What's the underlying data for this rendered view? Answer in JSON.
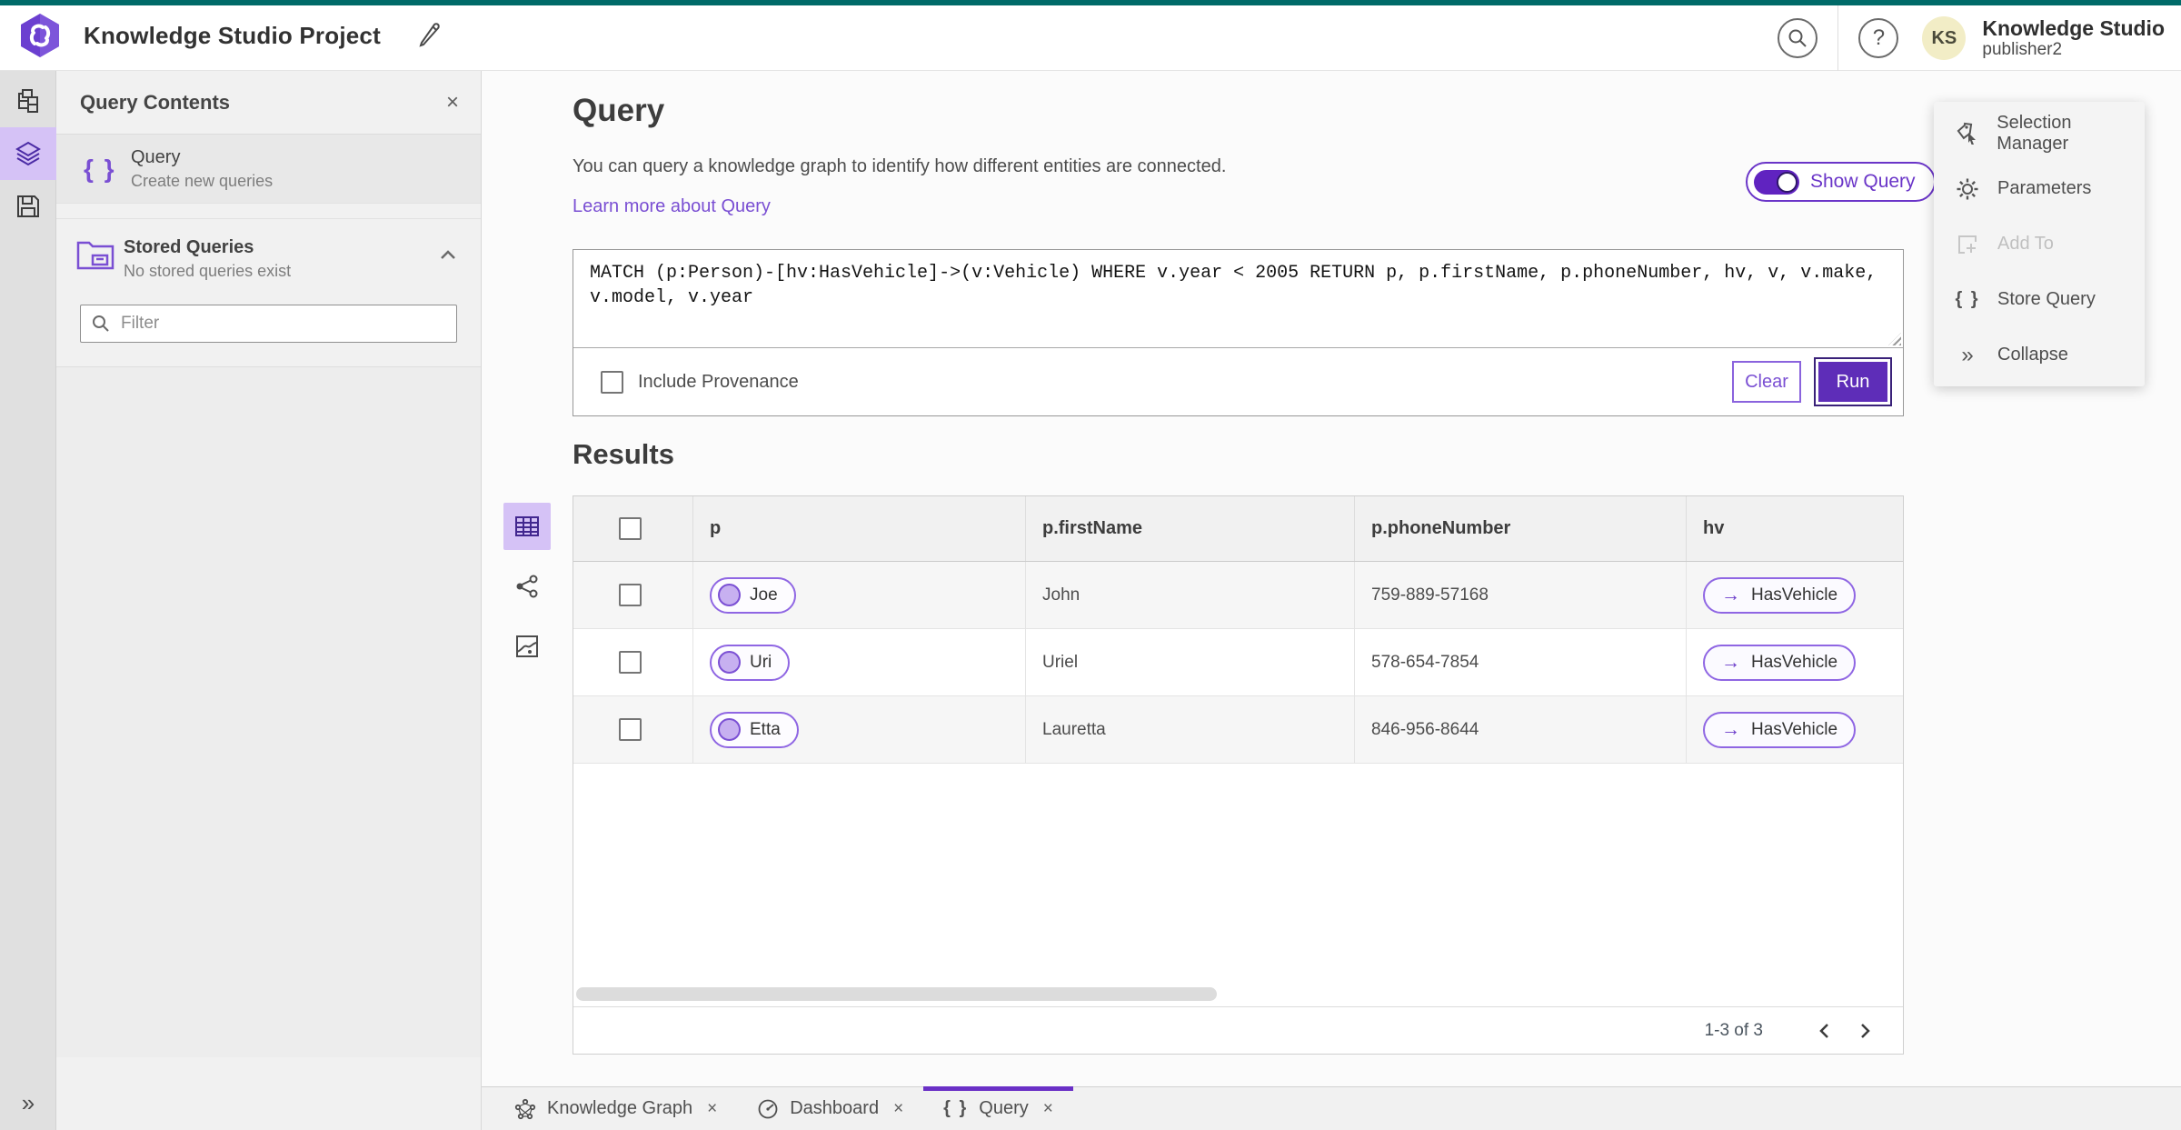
{
  "header": {
    "title": "Knowledge Studio Project",
    "account_name": "Knowledge Studio",
    "account_user": "publisher2",
    "avatar_initials": "KS",
    "help_glyph": "?"
  },
  "rail": {
    "expand_glyph": "»"
  },
  "panel": {
    "title": "Query Contents",
    "close_glyph": "×",
    "query_item": {
      "title": "Query",
      "subtitle": "Create new queries",
      "icon_glyph": "{ }"
    },
    "stored_queries": {
      "title": "Stored Queries",
      "subtitle": "No stored queries exist"
    },
    "filter_placeholder": "Filter"
  },
  "main": {
    "title": "Query",
    "description": "You can query a knowledge graph to identify how different entities are connected.",
    "learn_more": "Learn more about Query",
    "show_query_label": "Show Query",
    "query_text": "MATCH (p:Person)-[hv:HasVehicle]->(v:Vehicle) WHERE v.year < 2005 RETURN p, p.firstName, p.phoneNumber, hv, v, v.make, v.model, v.year",
    "include_provenance_label": "Include Provenance",
    "clear_label": "Clear",
    "run_label": "Run",
    "results_title": "Results"
  },
  "table": {
    "columns": {
      "p": "p",
      "firstName": "p.firstName",
      "phoneNumber": "p.phoneNumber",
      "hv": "hv"
    },
    "rows": [
      {
        "p": "Joe",
        "firstName": "John",
        "phoneNumber": "759-889-57168",
        "hv": "HasVehicle",
        "arrow": "→"
      },
      {
        "p": "Uri",
        "firstName": "Uriel",
        "phoneNumber": "578-654-7854",
        "hv": "HasVehicle",
        "arrow": "→"
      },
      {
        "p": "Etta",
        "firstName": "Lauretta",
        "phoneNumber": "846-956-8644",
        "hv": "HasVehicle",
        "arrow": "→"
      }
    ],
    "pagination_label": "1-3 of 3"
  },
  "context_menu": {
    "items": [
      {
        "label": "Selection Manager"
      },
      {
        "label": "Parameters"
      },
      {
        "label": "Add To"
      },
      {
        "label": "Store Query",
        "icon_glyph": "{ }"
      },
      {
        "label": "Collapse",
        "icon_glyph": "»"
      }
    ]
  },
  "tabs": [
    {
      "label": "Knowledge Graph",
      "close_glyph": "×"
    },
    {
      "label": "Dashboard",
      "close_glyph": "×"
    },
    {
      "label": "Query",
      "close_glyph": "×",
      "icon_glyph": "{ }"
    }
  ],
  "colors": {
    "accent_purple": "#6a30c6",
    "run_purple": "#5e2db8",
    "light_purple": "#d5c2f6",
    "teal_top": "#006a68",
    "link_purple": "#7a4fd3"
  }
}
